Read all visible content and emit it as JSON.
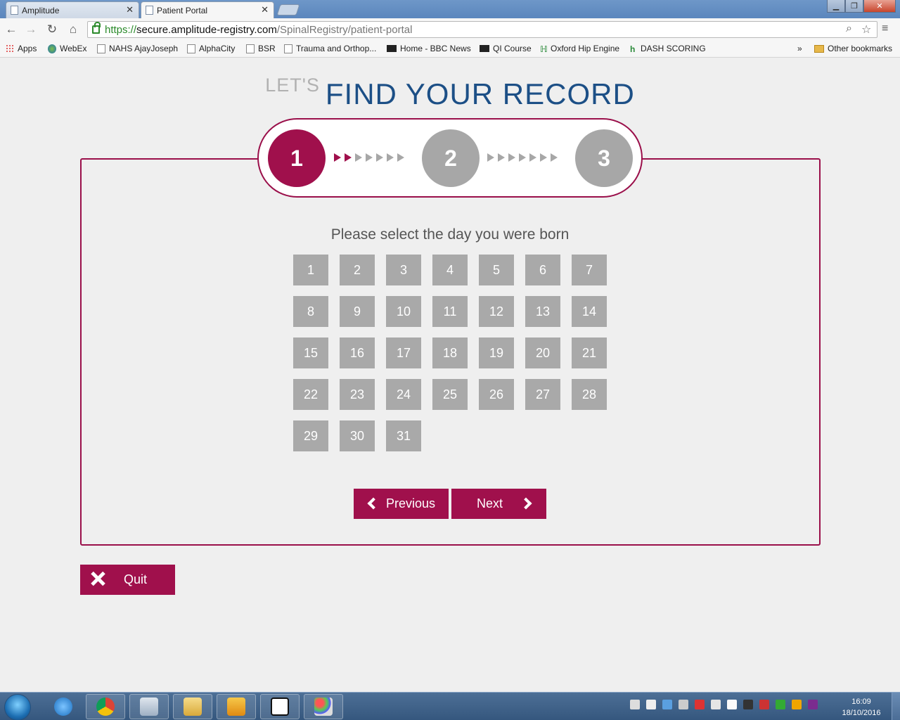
{
  "browser": {
    "tabs": [
      {
        "label": "Amplitude",
        "active": false
      },
      {
        "label": "Patient Portal",
        "active": true
      }
    ],
    "url": {
      "scheme": "https://",
      "host": "secure.amplitude-registry.com",
      "path": "/SpinalRegistry/patient-portal"
    },
    "bookmarks": [
      {
        "label": "Apps",
        "icon": "apps-grid-icon"
      },
      {
        "label": "WebEx",
        "icon": "globe-icon"
      },
      {
        "label": "NAHS AjayJoseph",
        "icon": "page-icon"
      },
      {
        "label": "AlphaCity",
        "icon": "page-icon"
      },
      {
        "label": "BSR",
        "icon": "page-icon"
      },
      {
        "label": "Trauma and Orthop...",
        "icon": "page-icon"
      },
      {
        "label": "Home - BBC News",
        "icon": "bbc-icon"
      },
      {
        "label": "QI Course",
        "icon": "bbc-icon"
      },
      {
        "label": "Oxford Hip Engine",
        "icon": "h-icon"
      },
      {
        "label": "DASH SCORING",
        "icon": "h-icon"
      }
    ],
    "bookmarks_overflow": "»",
    "other_bookmarks": "Other bookmarks"
  },
  "page": {
    "heading_prefix": "LET'S",
    "heading": "FIND YOUR RECORD",
    "steps": [
      "1",
      "2",
      "3"
    ],
    "current_step": 1,
    "progress_arrows_done": 2,
    "prompt": "Please select the day you were born",
    "days": [
      "1",
      "2",
      "3",
      "4",
      "5",
      "6",
      "7",
      "8",
      "9",
      "10",
      "11",
      "12",
      "13",
      "14",
      "15",
      "16",
      "17",
      "18",
      "19",
      "20",
      "21",
      "22",
      "23",
      "24",
      "25",
      "26",
      "27",
      "28",
      "29",
      "30",
      "31"
    ],
    "previous_label": "Previous",
    "next_label": "Next",
    "quit_label": "Quit",
    "accent_color": "#a0104c",
    "heading_color": "#1c4f86"
  },
  "taskbar": {
    "apps": [
      "internet-explorer-icon",
      "chrome-icon",
      "calculator-icon",
      "file-explorer-icon",
      "outlook-icon",
      "sirs-icon",
      "paint-icon"
    ],
    "clock_time": "16:09",
    "clock_date": "18/10/2016"
  }
}
